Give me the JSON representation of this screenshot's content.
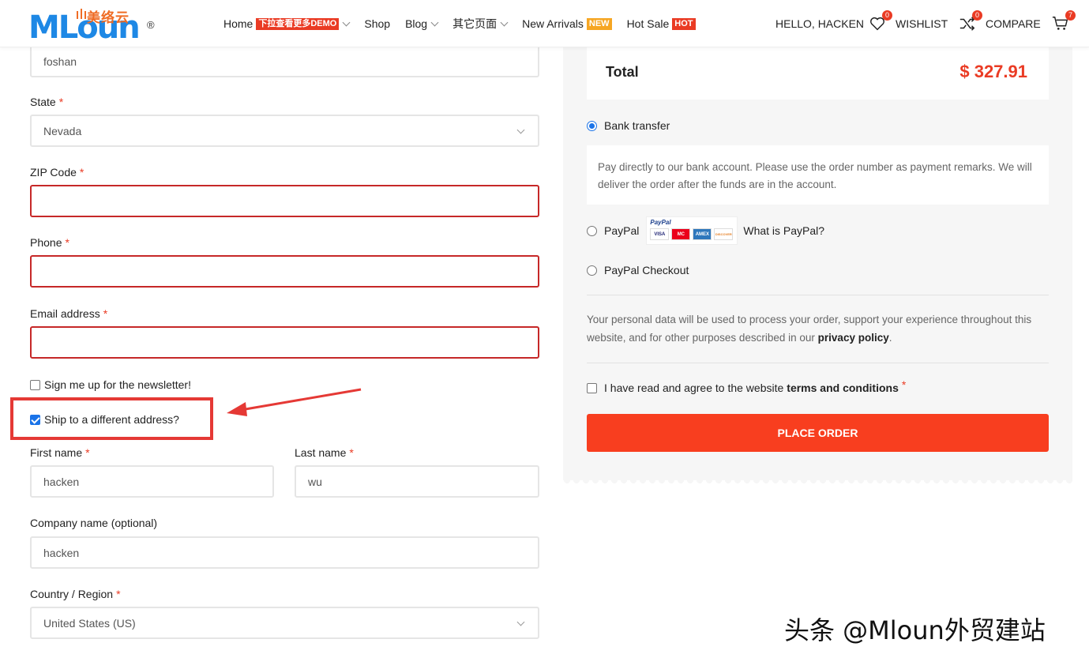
{
  "header": {
    "logo": {
      "text": "MLoun",
      "cn": "美络云",
      "reg": "®"
    },
    "nav": [
      {
        "label": "Home",
        "badge": "下拉查看更多DEMO",
        "badge_color": "#ea3b24",
        "has_dropdown": true
      },
      {
        "label": "Shop",
        "badge": "",
        "has_dropdown": false
      },
      {
        "label": "Blog",
        "badge": "",
        "has_dropdown": true
      },
      {
        "label": "其它页面",
        "badge": "",
        "has_dropdown": true
      },
      {
        "label": "New Arrivals",
        "badge": "NEW",
        "badge_color": "#f6a623",
        "has_dropdown": false
      },
      {
        "label": "Hot Sale",
        "badge": "HOT",
        "badge_color": "#ea3b24",
        "has_dropdown": false
      }
    ],
    "greeting": "HELLO, HACKEN",
    "wishlist": {
      "label": "WISHLIST",
      "count": "0",
      "icon": "heart-icon"
    },
    "compare": {
      "label": "COMPARE",
      "count": "0",
      "icon": "shuffle-icon"
    },
    "cart": {
      "count": "7",
      "icon": "cart-icon"
    }
  },
  "form": {
    "city_value": "foshan",
    "state": {
      "label": "State",
      "value": "Nevada"
    },
    "zip": {
      "label": "ZIP Code",
      "value": ""
    },
    "phone": {
      "label": "Phone",
      "value": ""
    },
    "email": {
      "label": "Email address",
      "value": ""
    },
    "newsletter": {
      "label": "Sign me up for the newsletter!",
      "checked": false
    },
    "ship_different": {
      "label": "Ship to a different address?",
      "checked": true
    },
    "first_name": {
      "label": "First name",
      "value": "hacken"
    },
    "last_name": {
      "label": "Last name",
      "value": "wu"
    },
    "company": {
      "label": "Company name (optional)",
      "value": "hacken"
    },
    "country": {
      "label": "Country / Region",
      "value": "United States (US)"
    },
    "required_mark": "*"
  },
  "order": {
    "total_label": "Total",
    "total_value": "$ 327.91",
    "payment_methods": [
      {
        "label": "Bank transfer",
        "selected": true
      },
      {
        "label": "PayPal",
        "selected": false,
        "link": "What is PayPal?"
      },
      {
        "label": "PayPal Checkout",
        "selected": false
      }
    ],
    "bank_desc": "Pay directly to our bank account. Please use the order number as payment remarks. We will deliver the order after the funds are in the account.",
    "paypal_logo": {
      "brand": "PayPal",
      "cards": [
        "VISA",
        "MC",
        "AMEX",
        "DISCOVER"
      ]
    },
    "privacy_text": "Your personal data will be used to process your order, support your experience throughout this website, and for other purposes described in our ",
    "privacy_link": "privacy policy",
    "privacy_end": ".",
    "terms_text": "I have read and agree to the website",
    "terms_link": "terms and conditions",
    "place_order": "PLACE ORDER"
  },
  "watermark": "头条 @Mloun外贸建站",
  "colors": {
    "accent": "#f83e1f",
    "error": "#c62828",
    "brand_blue": "#1e88e5",
    "highlight": "#e53935"
  }
}
